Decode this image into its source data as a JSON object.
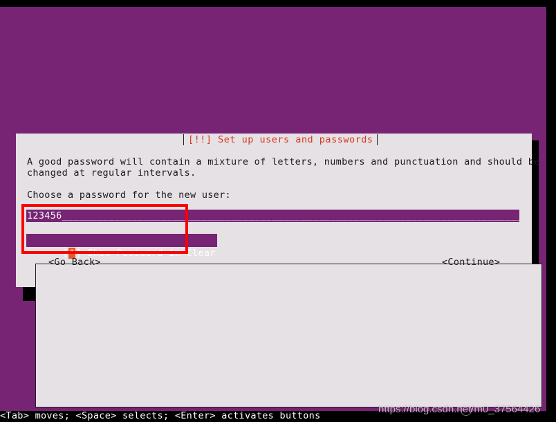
{
  "screen": {
    "background_color": "#762473",
    "letterbox_color": "#000000"
  },
  "dialog": {
    "title": "[!!] Set up users and passwords",
    "title_color": "#d4371f",
    "background_color": "#e6e1e5",
    "border_color": "#241f24",
    "intro_line_1": "A good password will contain a mixture of letters, numbers and punctuation and should be",
    "intro_line_2": "changed at regular intervals.",
    "prompt": "Choose a password for the new user:",
    "password_input": {
      "value": "123456",
      "filler": "______________________________________________________________________________________",
      "display": "123456______________________________________________________________________________________",
      "field_color": "#762473",
      "text_color": "#ffffff"
    },
    "show_password_checkbox": {
      "bracket_open": "[",
      "mark": "*",
      "bracket_close": "]",
      "label": " Show Password in Clear",
      "checked": true,
      "focused": true,
      "mark_color": "#e05d2a",
      "row_color": "#762473"
    },
    "buttons": {
      "go_back": "<Go Back>",
      "continue": "<Continue>"
    }
  },
  "annotation": {
    "box_color": "#fd0000",
    "box_label": "highlight-password-and-show-password"
  },
  "status_bar": {
    "help_text": "<Tab> moves; <Space> selects; <Enter> activates buttons",
    "text_color": "#ffffff"
  },
  "watermark": {
    "url": "https://blog.csdn.net/m0_37564426"
  }
}
